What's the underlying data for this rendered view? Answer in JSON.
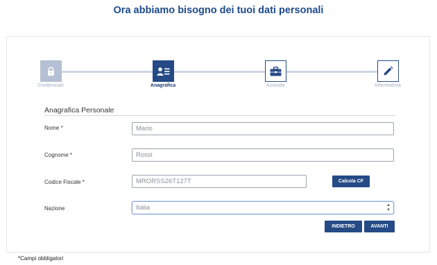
{
  "page": {
    "title": "Ora abbiamo bisogno dei tuoi dati personali"
  },
  "stepper": {
    "steps": [
      {
        "label": "Credenziali",
        "icon": "lock-icon",
        "state": "completed"
      },
      {
        "label": "Anagrafica",
        "icon": "id-card-icon",
        "state": "active"
      },
      {
        "label": "Azienda",
        "icon": "briefcase-icon",
        "state": "upcoming"
      },
      {
        "label": "Informativa",
        "icon": "pencil-icon",
        "state": "upcoming"
      }
    ]
  },
  "form": {
    "section_title": "Anagrafica Personale",
    "fields": {
      "nome": {
        "label": "Nome *",
        "value": "Mario"
      },
      "cognome": {
        "label": "Cognome *",
        "value": "Rossi"
      },
      "codice_fiscale": {
        "label": "Codice Fiscale *",
        "value": "MRORSS26T127T"
      },
      "nazione": {
        "label": "Nazione",
        "value": "Italia"
      }
    },
    "calcola_cf_label": "Calcola CF",
    "back_label": "INDIETRO",
    "next_label": "AVANTI"
  },
  "footnote": "*Campi obbligatori",
  "colors": {
    "primary": "#254a85",
    "completed": "#b5c0d4",
    "title": "#1d4a8c"
  }
}
